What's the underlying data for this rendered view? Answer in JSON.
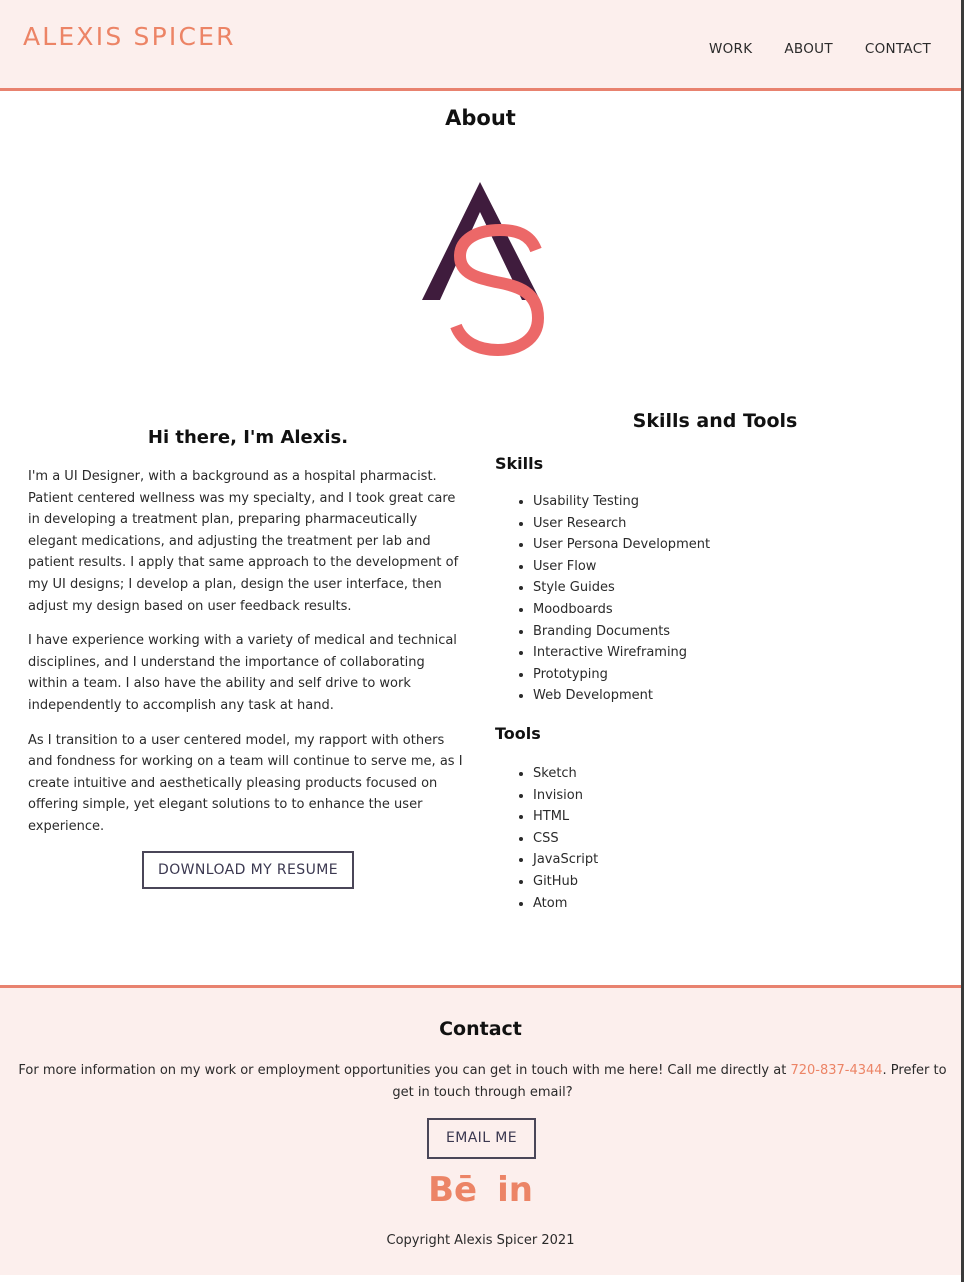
{
  "header": {
    "logo": "ALEXIS SPICER",
    "nav": [
      "WORK",
      "ABOUT",
      "CONTACT"
    ]
  },
  "about": {
    "title": "About",
    "monogram_letters": [
      "A",
      "S"
    ],
    "intro_heading": "Hi there, I'm Alexis.",
    "paragraphs": [
      "I'm a UI Designer, with a background as a hospital pharmacist. Patient centered wellness was my specialty, and I took great care in developing a treatment plan, preparing pharmaceutically elegant medications, and adjusting the treatment per lab and patient results. I apply that same approach to the development of my UI designs; I develop a plan, design the user interface, then adjust my design based on user feedback results.",
      "I have experience working with a variety of medical and technical disciplines, and I understand the importance of collaborating within a team. I also have the ability and self drive to work independently to accomplish any task at hand.",
      "As I transition to a user centered model, my rapport with others and fondness for working on a team will continue to serve me, as I create intuitive and aesthetically pleasing products focused on offering simple, yet elegant solutions to to enhance the user experience."
    ],
    "resume_button": "DOWNLOAD MY RESUME"
  },
  "skills": {
    "title": "Skills and Tools",
    "skills_heading": "Skills",
    "skills_list": [
      "Usability Testing",
      "User Research",
      "User Persona Development",
      "User Flow",
      "Style Guides",
      "Moodboards",
      "Branding Documents",
      "Interactive Wireframing",
      "Prototyping",
      "Web Development"
    ],
    "tools_heading": "Tools",
    "tools_list": [
      "Sketch",
      "Invision",
      "HTML",
      "CSS",
      "JavaScript",
      "GitHub",
      "Atom"
    ]
  },
  "contact": {
    "title": "Contact",
    "text_before": "For more information on my work or employment opportunities you can get in touch with me here! Call me directly at ",
    "phone": "720-837-4344",
    "text_after": ". Prefer to get in touch through email?",
    "email_button": "EMAIL ME",
    "social": [
      {
        "icon": "behance-icon",
        "glyph": "Bē"
      },
      {
        "icon": "linkedin-icon",
        "glyph": "in"
      }
    ],
    "copyright": "Copyright Alexis Spicer 2021"
  },
  "colors": {
    "accent": "#ec8466",
    "header_bg": "#fcefed",
    "monogram_a": "#3f1c3d",
    "monogram_s": "#ec6868",
    "button_border": "#4a4658"
  }
}
